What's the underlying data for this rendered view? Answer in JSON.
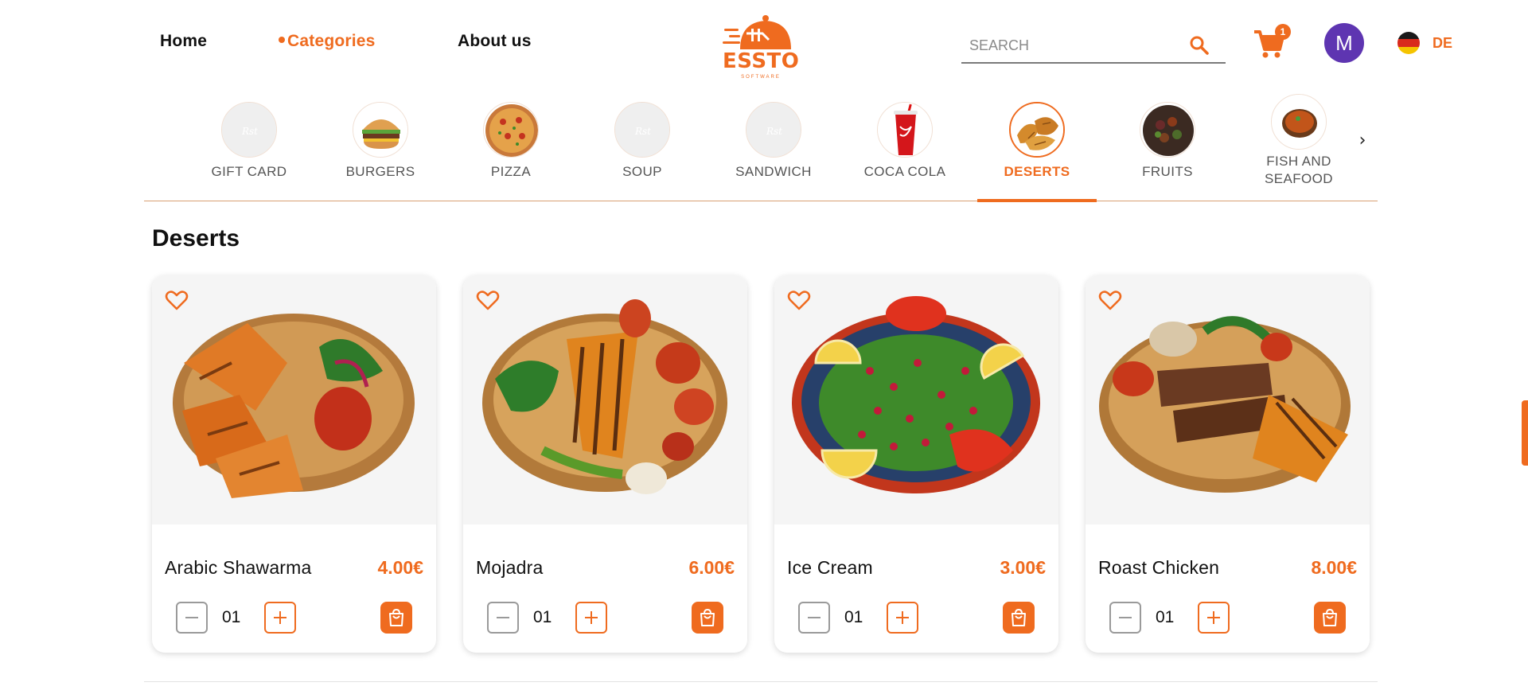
{
  "nav": {
    "home": "Home",
    "categories": "Categories",
    "about": "About us"
  },
  "logo": {
    "text": "ESSTO",
    "subtitle": "SOFTWARE"
  },
  "search": {
    "placeholder": "SEARCH",
    "value": ""
  },
  "cart": {
    "count": "1"
  },
  "user": {
    "initial": "M"
  },
  "language": {
    "code": "DE",
    "flag": "germany-flag"
  },
  "categories": [
    {
      "label": "GIFT CARD",
      "icon": "placeholder-logo",
      "active": false
    },
    {
      "label": "BURGERS",
      "icon": "burger",
      "active": false
    },
    {
      "label": "PIZZA",
      "icon": "pizza",
      "active": false
    },
    {
      "label": "SOUP",
      "icon": "placeholder-logo",
      "active": false
    },
    {
      "label": "SANDWICH",
      "icon": "placeholder-logo",
      "active": false
    },
    {
      "label": "COCA COLA",
      "icon": "cola-cup",
      "active": false
    },
    {
      "label": "DESERTS",
      "icon": "pastries",
      "active": true
    },
    {
      "label": "FRUITS",
      "icon": "fruit-bowl",
      "active": false
    },
    {
      "label": "FISH AND SEAFOOD",
      "icon": "soup-bowl",
      "active": false
    }
  ],
  "section": {
    "title": "Deserts"
  },
  "products": [
    {
      "name": "Arabic Shawarma",
      "price": "4.00€",
      "qty": "01"
    },
    {
      "name": "Mojadra",
      "price": "6.00€",
      "qty": "01"
    },
    {
      "name": "Ice Cream",
      "price": "3.00€",
      "qty": "01"
    },
    {
      "name": "Roast Chicken",
      "price": "8.00€",
      "qty": "01"
    }
  ],
  "colors": {
    "accent": "#ef6b1f",
    "avatar": "#5e35b1"
  }
}
